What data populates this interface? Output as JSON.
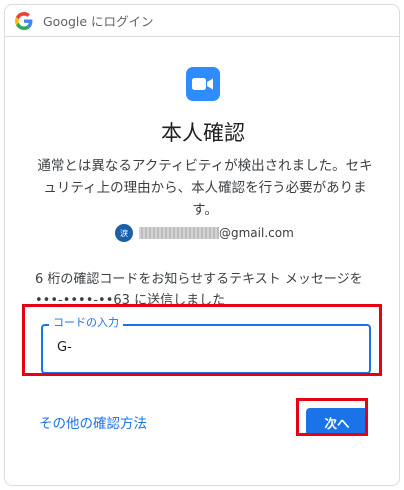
{
  "topbar": {
    "logo_icon": "google-g-icon",
    "title": "Google にログイン"
  },
  "app": {
    "logo_icon": "zoom-video-camera-icon",
    "brand_color": "#2D8CFF"
  },
  "heading": "本人確認",
  "description": "通常とは異なるアクティビティが検出されました。セキュリティ上の理由から、本人確認を行う必要があります。",
  "account": {
    "avatar_initial": "淚",
    "email_suffix": "@gmail.com"
  },
  "info_text": "6 桁の確認コードをお知らせするテキスト メッセージを •••-••••-••63 に送信しました",
  "code_field": {
    "label": "コードの入力",
    "value": "G-"
  },
  "actions": {
    "other_methods": "その他の確認方法",
    "next": "次へ",
    "accent_color": "#1a73e8",
    "highlight_color": "#e60012"
  }
}
